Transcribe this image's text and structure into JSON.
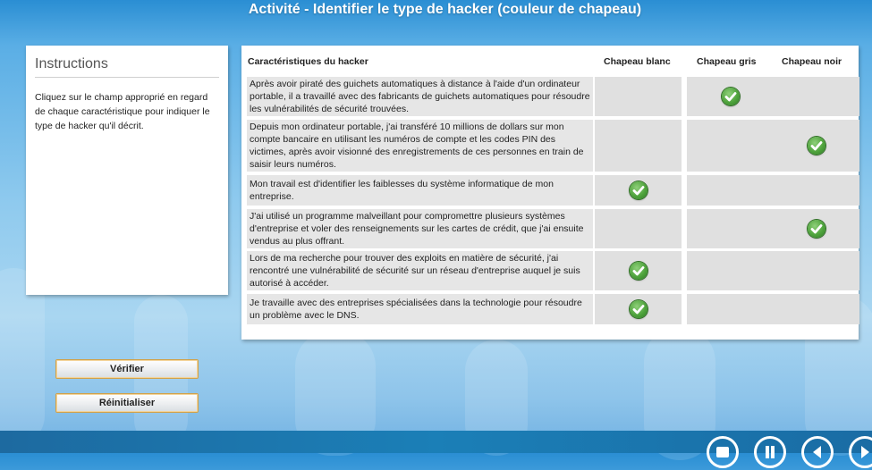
{
  "title": "Activité - Identifier le type de hacker (couleur de chapeau)",
  "instructions": {
    "heading": "Instructions",
    "body": "Cliquez sur le champ approprié en regard de chaque caractéristique pour indiquer le type de hacker qu'il décrit."
  },
  "buttons": {
    "verify": "Vérifier",
    "reset": "Réinitialiser"
  },
  "table": {
    "headers": {
      "feature": "Caractéristiques du hacker",
      "white": "Chapeau blanc",
      "gray": "Chapeau gris",
      "black": "Chapeau noir"
    },
    "rows": [
      {
        "text": "Après avoir piraté des guichets automatiques à distance à l'aide d'un ordinateur portable, il a travaillé avec des fabricants de guichets automatiques pour résoudre les vulnérabilités de sécurité trouvées.",
        "selected": "gray"
      },
      {
        "text": "Depuis mon ordinateur portable, j'ai transféré 10 millions de dollars sur mon compte bancaire en utilisant les numéros de compte et les codes PIN des victimes, après avoir visionné des enregistrements de ces personnes en train de saisir leurs numéros.",
        "selected": "black"
      },
      {
        "text": "Mon travail est d'identifier les faiblesses du système informatique de mon entreprise.",
        "selected": "white"
      },
      {
        "text": "J'ai utilisé un programme malveillant pour compromettre plusieurs systèmes d'entreprise et voler des renseignements sur les cartes de crédit, que j'ai ensuite vendus au plus offrant.",
        "selected": "black"
      },
      {
        "text": "Lors de ma recherche pour trouver des exploits en matière de sécurité, j'ai rencontré une vulnérabilité de sécurité sur un réseau d'entreprise auquel je suis autorisé à accéder.",
        "selected": "white"
      },
      {
        "text": "Je travaille avec des entreprises spécialisées dans la technologie pour résoudre un problème avec le DNS.",
        "selected": "white"
      }
    ]
  },
  "icons": {
    "check": "check-circle-icon",
    "nav": [
      "menu-icon",
      "pause-icon",
      "back-icon",
      "forward-icon"
    ]
  },
  "colors": {
    "check_green": "#4fa33d",
    "footer": "#1b7fb7",
    "button_border": "#d2a24a"
  }
}
